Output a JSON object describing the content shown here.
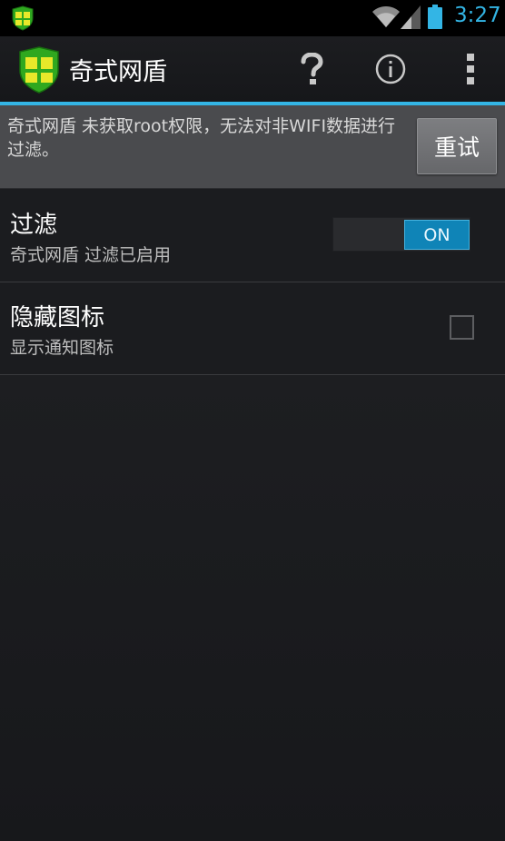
{
  "status_bar": {
    "time": "3:27",
    "icons": [
      "shield-notification-icon",
      "wifi-icon",
      "signal-icon",
      "battery-icon"
    ],
    "clock_color": "#33b5e5"
  },
  "action_bar": {
    "title": "奇式网盾",
    "actions": [
      "help-icon",
      "info-icon",
      "overflow-menu-icon"
    ]
  },
  "warning": {
    "message": "奇式网盾 未获取root权限，无法对非WIFI数据进行过滤。",
    "retry_label": "重试"
  },
  "preferences": {
    "filter": {
      "title": "过滤",
      "summary": "奇式网盾 过滤已启用",
      "switch_label": "ON",
      "enabled": true
    },
    "hide_icon": {
      "title": "隐藏图标",
      "summary": "显示通知图标",
      "checked": false
    }
  },
  "colors": {
    "accent": "#33b5e5",
    "switch_on": "#0f84b7",
    "shield_green": "#2fa81f",
    "shield_yellow": "#e8e82a"
  }
}
